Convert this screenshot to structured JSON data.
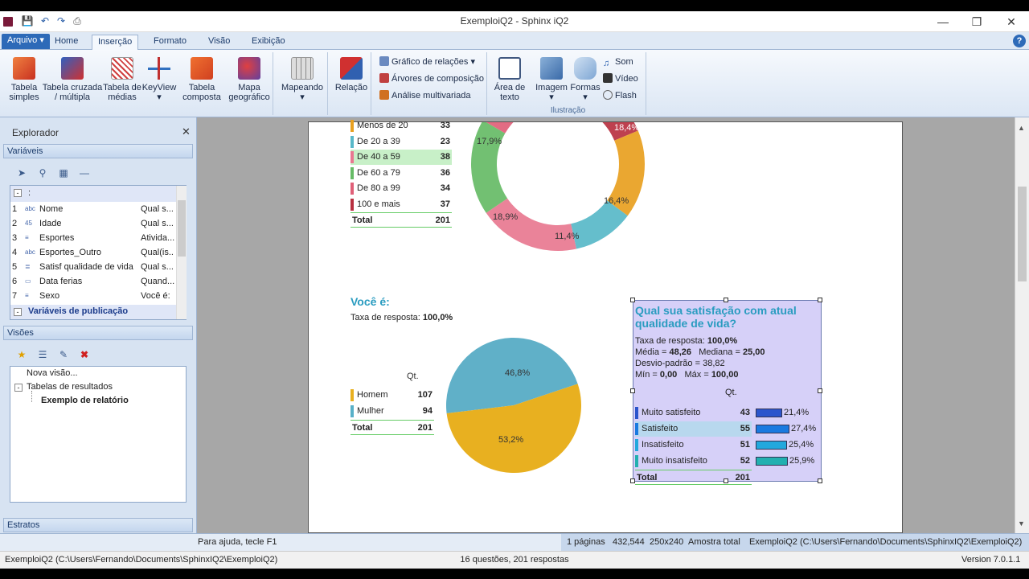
{
  "window": {
    "title": "ExemploiQ2 - Sphinx iQ2"
  },
  "menu_tabs": [
    "Arquivo",
    "Home",
    "Inserção",
    "Formato",
    "Visão",
    "Exibição"
  ],
  "ribbon": {
    "tabela_simples": "Tabela\nsimples",
    "tabela_cruzada": "Tabela cruzada\n/ múltipla",
    "tabela_medias": "Tabela de\nmédias",
    "keyview": "KeyView",
    "tabela_composta": "Tabela\ncomposta",
    "mapa": "Mapa\ngeográfico",
    "mapeando": "Mapeando",
    "relacao": "Relação",
    "grafico_relacoes": "Gráfico de relações",
    "arvores": "Árvores de composição",
    "analise": "Análise multivariada",
    "area_texto": "Área de\ntexto",
    "imagem": "Imagem",
    "formas": "Formas",
    "som": "Som",
    "video": "Vídeo",
    "flash": "Flash",
    "ilustracao": "Ilustração"
  },
  "explorer": {
    "title": "Explorador",
    "variaveis": "Variáveis",
    "root": ":",
    "variables": [
      {
        "n": "1",
        "icon": "abc",
        "name": "Nome",
        "type": "Qual s..."
      },
      {
        "n": "2",
        "icon": "45",
        "name": "Idade",
        "type": "Qual s..."
      },
      {
        "n": "3",
        "icon": "list",
        "name": "Esportes",
        "type": "Ativida..."
      },
      {
        "n": "4",
        "icon": "abc",
        "name": "Esportes_Outro",
        "type": "Qual(is..."
      },
      {
        "n": "5",
        "icon": "scale",
        "name": "Satisf qualidade de vida",
        "type": "Qual s..."
      },
      {
        "n": "6",
        "icon": "date",
        "name": "Data ferias",
        "type": "Quand..."
      },
      {
        "n": "7",
        "icon": "list",
        "name": "Sexo",
        "type": "Você é:"
      }
    ],
    "publicacao": "Variáveis de publicação",
    "visoes": "Visões",
    "tree": [
      "Nova visão...",
      "Tabelas de resultados",
      "Exemplo de relatório"
    ],
    "estratos": "Estratos"
  },
  "report": {
    "age_table": [
      {
        "label": "Menos de 20",
        "value": "33",
        "color": "#e8a020"
      },
      {
        "label": "De 20 a 39",
        "value": "23",
        "color": "#58b8c8"
      },
      {
        "label": "De 40 a 59",
        "value": "38",
        "color": "#e87890"
      },
      {
        "label": "De 60 a 79",
        "value": "36",
        "color": "#66bb66"
      },
      {
        "label": "De 80 a 99",
        "value": "34",
        "color": "#e06078"
      },
      {
        "label": "100 e mais",
        "value": "37",
        "color": "#b83040"
      }
    ],
    "age_total_label": "Total",
    "age_total": "201",
    "donut_labels": [
      "18,4%",
      "17,9%",
      "16,4%",
      "18,9%",
      "11,4%"
    ],
    "voce_title": "Você é:",
    "voce_taxa_label": "Taxa de resposta:",
    "voce_taxa": "100,0%",
    "qt_label": "Qt.",
    "sex_table": [
      {
        "label": "Homem",
        "value": "107",
        "color": "#e8b020"
      },
      {
        "label": "Mulher",
        "value": "94",
        "color": "#58b0c8"
      }
    ],
    "sex_total_label": "Total",
    "sex_total": "201",
    "pie_labels": [
      "46,8%",
      "53,2%"
    ],
    "sat_title": "Qual sua satisfação com atual qualidade de vida?",
    "sat_taxa_label": "Taxa de resposta:",
    "sat_taxa": "100,0%",
    "media_label": "Média =",
    "media": "48,26",
    "mediana_label": "Mediana =",
    "mediana": "25,00",
    "desvio_label": "Desvio-padrão =",
    "desvio": "38,82",
    "min_label": "Mín =",
    "min": "0,00",
    "max_label": "Máx =",
    "max": "100,00",
    "sat_table": [
      {
        "label": "Muito satisfeito",
        "value": "43",
        "pct": "21,4%",
        "frac": 0.214,
        "color": "#2b55cc"
      },
      {
        "label": "Satisfeito",
        "value": "55",
        "pct": "27,4%",
        "frac": 0.274,
        "color": "#1a7ae0"
      },
      {
        "label": "Insatisfeito",
        "value": "51",
        "pct": "25,4%",
        "frac": 0.254,
        "color": "#22a8dd"
      },
      {
        "label": "Muito insatisfeito",
        "value": "52",
        "pct": "25,9%",
        "frac": 0.259,
        "color": "#22b0b0"
      }
    ],
    "sat_total_label": "Total",
    "sat_total": "201"
  },
  "status": {
    "help": "Para ajuda, tecle F1",
    "pages": "1 páginas",
    "coords": "432,544",
    "size": "250x240",
    "amostra": "Amostra total",
    "path": "ExemploiQ2 (C:\\Users\\Fernando\\Documents\\SphinxIQ2\\ExemploiQ2)",
    "file": "ExemploiQ2 (C:\\Users\\Fernando\\Documents\\SphinxIQ2\\ExemploiQ2)",
    "summary": "16 questões, 201 respostas",
    "version": "Version 7.0.1.1"
  }
}
